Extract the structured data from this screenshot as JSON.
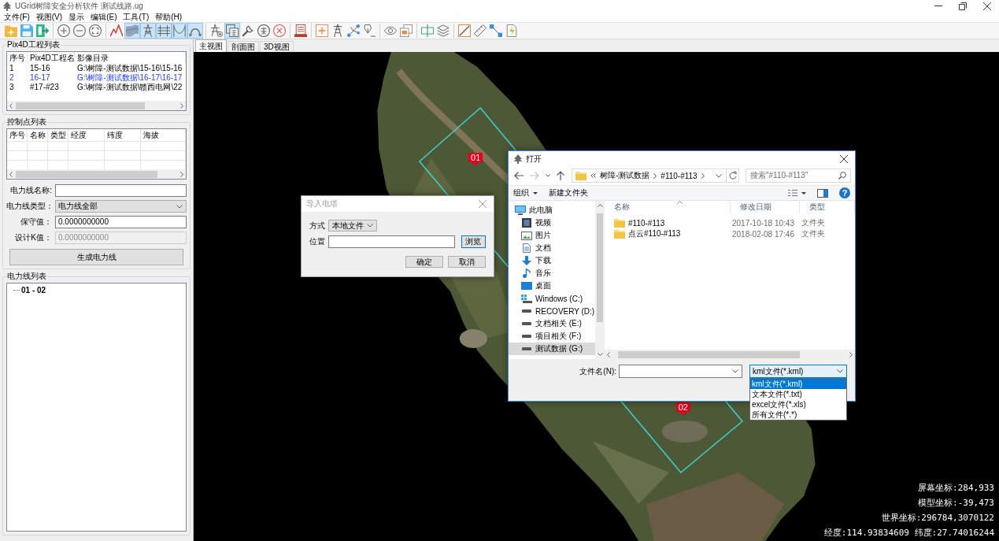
{
  "window": {
    "title": "UGrid树障安全分析软件 测试线路.ug"
  },
  "menu": [
    {
      "label": "文件(F)"
    },
    {
      "label": "视图(V)"
    },
    {
      "label": "显示"
    },
    {
      "label": "编辑(E)"
    },
    {
      "label": "工具(T)"
    },
    {
      "label": "帮助(H)"
    }
  ],
  "toolbar": {
    "groups": [
      {
        "buttons": [
          {
            "on": false
          },
          {
            "on": false
          },
          {
            "on": false
          }
        ]
      },
      {
        "buttons": [
          {
            "on": false
          },
          {
            "on": false
          },
          {
            "on": false
          }
        ]
      },
      {
        "buttons": [
          {
            "on": false
          },
          {
            "on": true
          },
          {
            "on": true
          },
          {
            "on": true
          },
          {
            "on": true
          },
          {
            "on": true
          }
        ]
      },
      {
        "buttons": [
          {
            "on": false
          },
          {
            "on": true
          },
          {
            "on": false
          },
          {
            "on": false
          },
          {
            "on": false
          }
        ]
      },
      {
        "buttons": [
          {
            "on": false
          }
        ]
      },
      {
        "buttons": [
          {
            "on": false
          },
          {
            "on": false
          },
          {
            "on": false
          },
          {
            "on": false
          }
        ]
      },
      {
        "buttons": [
          {
            "on": false
          },
          {
            "on": false
          }
        ]
      },
      {
        "buttons": [
          {
            "on": false
          },
          {
            "on": false
          }
        ]
      },
      {
        "buttons": [
          {
            "on": false
          },
          {
            "on": false
          },
          {
            "on": false
          },
          {
            "on": false
          }
        ]
      }
    ]
  },
  "pix4d_projects": {
    "title": "Pix4D工程列表",
    "columns": [
      "序号",
      "Pix4D工程名",
      "影像目录"
    ],
    "rows": [
      {
        "cells": [
          "1",
          "15-16",
          "G:\\树障-测试数据\\15-16\\15-16"
        ],
        "selected": false
      },
      {
        "cells": [
          "2",
          "16-17",
          "G:\\树障-测试数据\\16-17\\16-17"
        ],
        "selected": true
      },
      {
        "cells": [
          "3",
          "#17-#23",
          "G:\\树障-测试数据\\赣西电网\\22"
        ],
        "selected": false
      }
    ]
  },
  "control_points": {
    "title": "控制点列表",
    "columns": [
      "序号",
      "名称",
      "类型",
      "经度",
      "纬度",
      "海拔"
    ]
  },
  "power_line_form": {
    "fields": [
      {
        "kind": "text",
        "label": "电力线名称:",
        "disabled": false
      },
      {
        "kind": "select",
        "label": "电力线类型：",
        "value": "电力线全部",
        "disabled": false
      },
      {
        "kind": "text",
        "label": "保守值：",
        "value": "0.0000000000",
        "disabled": false
      },
      {
        "kind": "text",
        "label": "设计K值：",
        "value": "0.0000000000",
        "disabled": true
      }
    ],
    "button": "生成电力线"
  },
  "power_lines": {
    "title": "电力线列表",
    "items": [
      {
        "label": "01 - 02"
      }
    ]
  },
  "view_tabs": [
    {
      "label": "主视图",
      "selected": true
    },
    {
      "label": "剖面图",
      "selected": false
    },
    {
      "label": "3D视图",
      "selected": false
    }
  ],
  "scene": {
    "markers": [
      {
        "label": "01"
      },
      {
        "label": "02"
      }
    ],
    "readouts": [
      "屏幕坐标:284,933",
      "模型坐标:-39,473",
      "世界坐标:296784,3070122",
      "经度:114.93834609 纬度:27.74016244"
    ]
  },
  "import_dialog": {
    "title": "导入电塔",
    "method": {
      "label": "方式",
      "value": "本地文件"
    },
    "location": {
      "label": "位置"
    },
    "browse_button": "浏览",
    "buttons": [
      "确定",
      "取消"
    ]
  },
  "open_dialog": {
    "title": "打开",
    "back": {
      "disabled": false
    },
    "forward": {
      "disabled": true
    },
    "path": [
      "树障-测试数据",
      "#110-#113"
    ],
    "search": {
      "placeholder": "搜索\"#110-#113\""
    },
    "commands": [
      {
        "label": "组织",
        "kind": "menu"
      },
      {
        "label": "新建文件夹",
        "kind": "button"
      }
    ],
    "help": "?",
    "nav": [
      {
        "label": "此电脑",
        "kind": "computer",
        "selected": false,
        "children": [
          {
            "label": "视频",
            "kind": "videos",
            "selected": false
          },
          {
            "label": "图片",
            "kind": "pictures",
            "selected": false
          },
          {
            "label": "文档",
            "kind": "documents",
            "selected": false
          },
          {
            "label": "下载",
            "kind": "downloads",
            "selected": false
          },
          {
            "label": "音乐",
            "kind": "music",
            "selected": false
          },
          {
            "label": "桌面",
            "kind": "desktop",
            "selected": false
          },
          {
            "label": "Windows (C:)",
            "kind": "system_drive",
            "selected": false
          },
          {
            "label": "RECOVERY (D:)",
            "kind": "drive",
            "selected": false
          },
          {
            "label": "文档相关 (E:)",
            "kind": "drive",
            "selected": false
          },
          {
            "label": "项目相关 (F:)",
            "kind": "drive",
            "selected": false
          },
          {
            "label": "测试数据 (G:)",
            "kind": "drive",
            "selected": true
          }
        ]
      }
    ],
    "columns": [
      "名称",
      "修改日期",
      "类型"
    ],
    "files": [
      {
        "cells": [
          "#110-#113",
          "2017-10-18 10:43",
          "文件夹"
        ],
        "selected": false
      },
      {
        "cells": [
          "点云#110-#113",
          "2018-02-08 17:46",
          "文件夹"
        ],
        "selected": false
      }
    ],
    "filename": {
      "label": "文件名(N):"
    },
    "filter": {
      "value": "kml文件(*.kml)",
      "expanded": true,
      "options": [
        {
          "label": "kml文件(*.kml)",
          "selected": true
        },
        {
          "label": "文本文件(*.txt)",
          "selected": false
        },
        {
          "label": "excel文件(*.xls)",
          "selected": false
        },
        {
          "label": "所有文件(*.*)",
          "selected": false
        }
      ]
    }
  }
}
